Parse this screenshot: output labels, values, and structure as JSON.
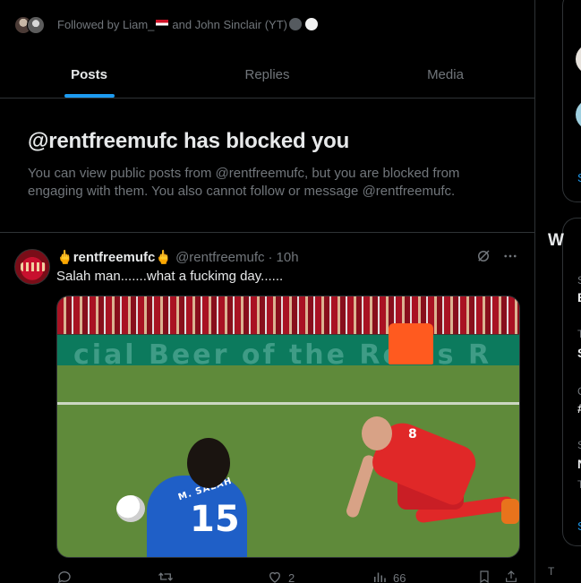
{
  "followed_by": {
    "prefix": "Followed by Liam_",
    "middle": "and John Sinclair (YT)"
  },
  "tabs": [
    {
      "label": "Posts",
      "active": true
    },
    {
      "label": "Replies",
      "active": false
    },
    {
      "label": "Media",
      "active": false
    }
  ],
  "blocked": {
    "title": "@rentfreemufc has blocked you",
    "body": "You can view public posts from @rentfreemufc, but you are blocked from engaging with them. You also cannot follow or message @rentfreemufc."
  },
  "tweet": {
    "name": "rentfreemufc",
    "name_prefix_emoji": "🖕",
    "name_suffix_emoji": "🖕",
    "handle": "@rentfreemufc",
    "separator": "·",
    "time": "10h",
    "text": "Salah man.......what a fuckimg day......",
    "media": {
      "hoarding_text": "cial Beer of the Re us R",
      "player1_number": "15",
      "player1_name": "M. SALAH",
      "player2_number": "8"
    },
    "actions": {
      "reply_count": "",
      "retweet_count": "",
      "like_count": "2",
      "view_count": "66"
    },
    "icons": {
      "grok": "grok-icon",
      "more": "more-icon",
      "reply": "reply-icon",
      "retweet": "retweet-icon",
      "like": "heart-icon",
      "views": "views-icon",
      "bookmark": "bookmark-icon",
      "share": "share-icon"
    }
  },
  "right_column": {
    "card1_show_more": "S",
    "card2_title": "W",
    "card2_items": [
      {
        "small": "S",
        "bold": "E"
      },
      {
        "small": "T",
        "bold": "S"
      },
      {
        "small": "C",
        "bold": "#"
      },
      {
        "small": "S",
        "bold": "N",
        "extra": "T"
      }
    ],
    "card2_show_more": "S",
    "footer": "T"
  },
  "colors": {
    "background": "#000000",
    "text_primary": "#e7e9ea",
    "text_secondary": "#71767b",
    "accent": "#1d9bf0",
    "border": "#2f3336"
  }
}
